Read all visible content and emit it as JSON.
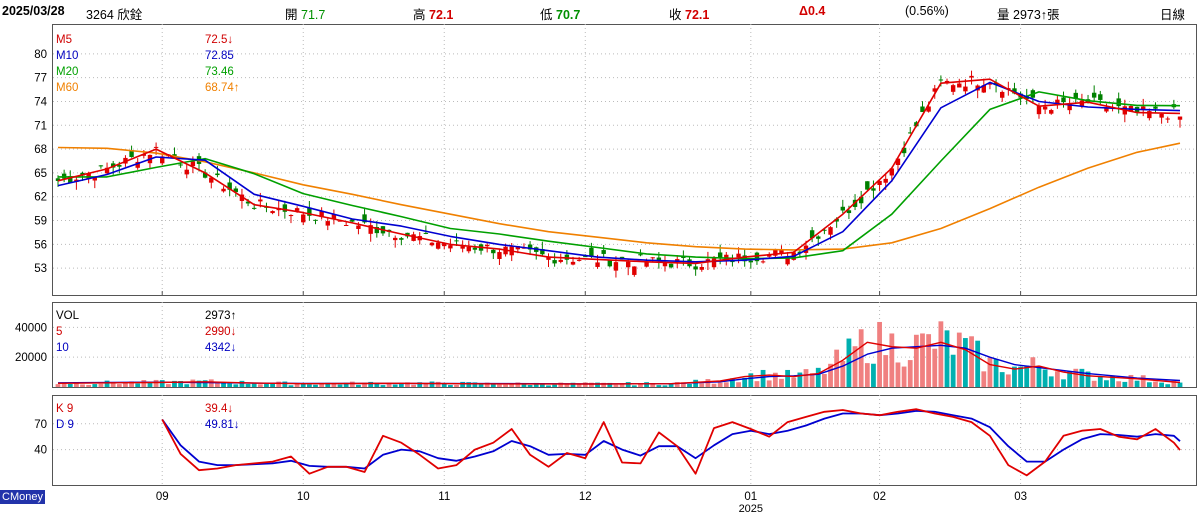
{
  "header": {
    "date": "2025/03/28",
    "stock": "3264 欣銓",
    "open_label": "開",
    "open": "71.7",
    "high_label": "高",
    "high": "72.1",
    "low_label": "低",
    "low": "70.7",
    "close_label": "收",
    "close": "72.1",
    "change": "Δ0.4",
    "change_pct": "(0.56%)",
    "volume_label": "量",
    "volume": "2973↑張",
    "period": "日線"
  },
  "brand": "CMoney",
  "colors": {
    "up": "#e00000",
    "down": "#008000",
    "ma5": "#e00000",
    "ma10": "#0000d0",
    "ma20": "#00a000",
    "ma60": "#f08000",
    "vol_up": "#f08080",
    "vol_down": "#00b0b0",
    "k": "#e00000",
    "d": "#0000d0"
  },
  "chart_data": [
    {
      "type": "candlestick",
      "panel": "price",
      "ylim": [
        50,
        83
      ],
      "yticks": [
        53,
        56,
        59,
        62,
        65,
        68,
        71,
        74,
        77,
        80
      ],
      "legend": [
        {
          "name": "M5",
          "value": "72.5↓"
        },
        {
          "name": "M10",
          "value": "72.85"
        },
        {
          "name": "M20",
          "value": "73.46"
        },
        {
          "name": "M60",
          "value": "68.74↑"
        }
      ],
      "ma60_points": [
        [
          0,
          68.2
        ],
        [
          8,
          68.1
        ],
        [
          16,
          67.5
        ],
        [
          24,
          66.4
        ],
        [
          32,
          65.0
        ],
        [
          40,
          63.5
        ],
        [
          48,
          62.3
        ],
        [
          56,
          61.0
        ],
        [
          64,
          59.8
        ],
        [
          72,
          58.6
        ],
        [
          80,
          57.6
        ],
        [
          88,
          56.9
        ],
        [
          96,
          56.2
        ],
        [
          104,
          55.7
        ],
        [
          112,
          55.4
        ],
        [
          120,
          55.3
        ],
        [
          128,
          55.4
        ],
        [
          136,
          56.2
        ],
        [
          144,
          58.0
        ],
        [
          152,
          60.5
        ],
        [
          160,
          63.2
        ],
        [
          168,
          65.6
        ],
        [
          176,
          67.6
        ],
        [
          183,
          68.74
        ]
      ],
      "ma20_points": [
        [
          0,
          64.5
        ],
        [
          8,
          64.5
        ],
        [
          16,
          65.7
        ],
        [
          24,
          66.8
        ],
        [
          32,
          64.9
        ],
        [
          40,
          62.4
        ],
        [
          48,
          60.9
        ],
        [
          56,
          59.5
        ],
        [
          64,
          58.0
        ],
        [
          72,
          57.3
        ],
        [
          80,
          56.4
        ],
        [
          88,
          55.6
        ],
        [
          96,
          54.8
        ],
        [
          104,
          54.4
        ],
        [
          112,
          54.2
        ],
        [
          120,
          54.3
        ],
        [
          128,
          55.2
        ],
        [
          136,
          59.8
        ],
        [
          144,
          66.5
        ],
        [
          152,
          73.0
        ],
        [
          160,
          75.2
        ],
        [
          168,
          74.1
        ],
        [
          176,
          73.5
        ],
        [
          183,
          73.46
        ]
      ],
      "ma10_points": [
        [
          0,
          63.4
        ],
        [
          8,
          64.8
        ],
        [
          16,
          67.0
        ],
        [
          24,
          66.6
        ],
        [
          32,
          62.3
        ],
        [
          40,
          60.8
        ],
        [
          48,
          59.2
        ],
        [
          56,
          58.3
        ],
        [
          64,
          57.0
        ],
        [
          72,
          56.0
        ],
        [
          80,
          55.2
        ],
        [
          88,
          54.4
        ],
        [
          96,
          54.0
        ],
        [
          104,
          53.8
        ],
        [
          112,
          54.0
        ],
        [
          120,
          54.5
        ],
        [
          128,
          57.6
        ],
        [
          136,
          64.0
        ],
        [
          144,
          73.2
        ],
        [
          152,
          76.4
        ],
        [
          160,
          74.0
        ],
        [
          168,
          73.3
        ],
        [
          176,
          73.0
        ],
        [
          183,
          72.85
        ]
      ],
      "ma5_points": [
        [
          0,
          64.0
        ],
        [
          8,
          65.5
        ],
        [
          16,
          68.0
        ],
        [
          24,
          65.0
        ],
        [
          32,
          61.0
        ],
        [
          40,
          60.0
        ],
        [
          48,
          58.7
        ],
        [
          56,
          57.3
        ],
        [
          64,
          56.0
        ],
        [
          72,
          55.4
        ],
        [
          80,
          54.4
        ],
        [
          88,
          54.1
        ],
        [
          96,
          53.8
        ],
        [
          104,
          53.6
        ],
        [
          112,
          54.4
        ],
        [
          120,
          55.0
        ],
        [
          128,
          59.8
        ],
        [
          136,
          65.6
        ],
        [
          144,
          76.3
        ],
        [
          152,
          76.8
        ],
        [
          160,
          73.4
        ],
        [
          168,
          73.9
        ],
        [
          176,
          72.6
        ],
        [
          183,
          72.5
        ]
      ],
      "x_axis": {
        "labels": [
          {
            "i": 17,
            "text": "09"
          },
          {
            "i": 40,
            "text": "10"
          },
          {
            "i": 63,
            "text": "11"
          },
          {
            "i": 86,
            "text": "12"
          },
          {
            "i": 113,
            "text": "01"
          },
          {
            "i": 134,
            "text": "02"
          },
          {
            "i": 157,
            "text": "03"
          }
        ],
        "year": {
          "i": 113,
          "text": "2025"
        }
      }
    },
    {
      "type": "bar",
      "panel": "volume",
      "ylim": [
        0,
        55000
      ],
      "yticks": [
        20000,
        40000
      ],
      "legend": [
        {
          "name": "VOL",
          "value": "2973↑"
        },
        {
          "name": "5",
          "value": "2990↓"
        },
        {
          "name": "10",
          "value": "4342↓"
        }
      ],
      "ma5_points": [
        [
          0,
          2500
        ],
        [
          16,
          3000
        ],
        [
          24,
          3500
        ],
        [
          32,
          2600
        ],
        [
          40,
          2200
        ],
        [
          56,
          2500
        ],
        [
          72,
          2100
        ],
        [
          88,
          2000
        ],
        [
          100,
          2200
        ],
        [
          108,
          4000
        ],
        [
          112,
          7000
        ],
        [
          116,
          8000
        ],
        [
          120,
          7000
        ],
        [
          124,
          9000
        ],
        [
          128,
          18000
        ],
        [
          132,
          30000
        ],
        [
          136,
          27000
        ],
        [
          140,
          26000
        ],
        [
          144,
          30000
        ],
        [
          148,
          25000
        ],
        [
          152,
          15000
        ],
        [
          156,
          12000
        ],
        [
          160,
          14000
        ],
        [
          164,
          10000
        ],
        [
          168,
          7500
        ],
        [
          172,
          6500
        ],
        [
          176,
          5500
        ],
        [
          183,
          2990
        ]
      ],
      "ma10_points": [
        [
          0,
          2800
        ],
        [
          16,
          3200
        ],
        [
          24,
          3000
        ],
        [
          32,
          2600
        ],
        [
          40,
          2400
        ],
        [
          56,
          2400
        ],
        [
          72,
          2300
        ],
        [
          88,
          2100
        ],
        [
          100,
          2200
        ],
        [
          108,
          3500
        ],
        [
          112,
          5500
        ],
        [
          116,
          7000
        ],
        [
          120,
          7500
        ],
        [
          124,
          8500
        ],
        [
          128,
          14000
        ],
        [
          132,
          22000
        ],
        [
          136,
          26000
        ],
        [
          140,
          27000
        ],
        [
          144,
          28000
        ],
        [
          148,
          26000
        ],
        [
          152,
          20000
        ],
        [
          156,
          15000
        ],
        [
          160,
          13000
        ],
        [
          164,
          11000
        ],
        [
          168,
          9000
        ],
        [
          172,
          7500
        ],
        [
          176,
          6000
        ],
        [
          183,
          4342
        ]
      ]
    },
    {
      "type": "line",
      "panel": "kd",
      "ylim": [
        0,
        100
      ],
      "yticks": [
        40,
        70
      ],
      "series": [
        {
          "name": "K 9",
          "value": "39.4↓",
          "points": [
            [
              17,
              75
            ],
            [
              20,
              35
            ],
            [
              23,
              16
            ],
            [
              26,
              18
            ],
            [
              29,
              22
            ],
            [
              32,
              24
            ],
            [
              35,
              26
            ],
            [
              38,
              32
            ],
            [
              41,
              12
            ],
            [
              44,
              20
            ],
            [
              47,
              20
            ],
            [
              50,
              14
            ],
            [
              53,
              56
            ],
            [
              56,
              48
            ],
            [
              59,
              34
            ],
            [
              62,
              18
            ],
            [
              65,
              22
            ],
            [
              68,
              40
            ],
            [
              71,
              48
            ],
            [
              74,
              64
            ],
            [
              77,
              34
            ],
            [
              80,
              20
            ],
            [
              83,
              36
            ],
            [
              86,
              30
            ],
            [
              89,
              72
            ],
            [
              92,
              25
            ],
            [
              95,
              24
            ],
            [
              98,
              60
            ],
            [
              101,
              44
            ],
            [
              104,
              12
            ],
            [
              107,
              65
            ],
            [
              110,
              72
            ],
            [
              113,
              64
            ],
            [
              116,
              55
            ],
            [
              119,
              72
            ],
            [
              122,
              78
            ],
            [
              125,
              84
            ],
            [
              128,
              86
            ],
            [
              131,
              82
            ],
            [
              134,
              80
            ],
            [
              137,
              84
            ],
            [
              140,
              87
            ],
            [
              143,
              82
            ],
            [
              146,
              78
            ],
            [
              149,
              72
            ],
            [
              152,
              56
            ],
            [
              155,
              22
            ],
            [
              158,
              10
            ],
            [
              161,
              26
            ],
            [
              164,
              56
            ],
            [
              167,
              62
            ],
            [
              170,
              64
            ],
            [
              173,
              55
            ],
            [
              176,
              52
            ],
            [
              179,
              64
            ],
            [
              182,
              48
            ],
            [
              183,
              39.4
            ]
          ]
        },
        {
          "name": "D 9",
          "value": "49.81↓",
          "points": [
            [
              17,
              75
            ],
            [
              20,
              45
            ],
            [
              23,
              26
            ],
            [
              26,
              22
            ],
            [
              29,
              22
            ],
            [
              32,
              23
            ],
            [
              35,
              24
            ],
            [
              38,
              27
            ],
            [
              41,
              21
            ],
            [
              44,
              20
            ],
            [
              47,
              20
            ],
            [
              50,
              18
            ],
            [
              53,
              34
            ],
            [
              56,
              40
            ],
            [
              59,
              38
            ],
            [
              62,
              30
            ],
            [
              65,
              27
            ],
            [
              68,
              32
            ],
            [
              71,
              38
            ],
            [
              74,
              50
            ],
            [
              77,
              44
            ],
            [
              80,
              34
            ],
            [
              83,
              35
            ],
            [
              86,
              34
            ],
            [
              89,
              50
            ],
            [
              92,
              40
            ],
            [
              95,
              33
            ],
            [
              98,
              44
            ],
            [
              101,
              44
            ],
            [
              104,
              30
            ],
            [
              107,
              45
            ],
            [
              110,
              58
            ],
            [
              113,
              62
            ],
            [
              116,
              58
            ],
            [
              119,
              62
            ],
            [
              122,
              68
            ],
            [
              125,
              76
            ],
            [
              128,
              82
            ],
            [
              131,
              82
            ],
            [
              134,
              80
            ],
            [
              137,
              82
            ],
            [
              140,
              85
            ],
            [
              143,
              84
            ],
            [
              146,
              80
            ],
            [
              149,
              76
            ],
            [
              152,
              66
            ],
            [
              155,
              44
            ],
            [
              158,
              26
            ],
            [
              161,
              26
            ],
            [
              164,
              40
            ],
            [
              167,
              52
            ],
            [
              170,
              58
            ],
            [
              173,
              57
            ],
            [
              176,
              55
            ],
            [
              179,
              58
            ],
            [
              182,
              56
            ],
            [
              183,
              49.81
            ]
          ]
        }
      ]
    }
  ]
}
